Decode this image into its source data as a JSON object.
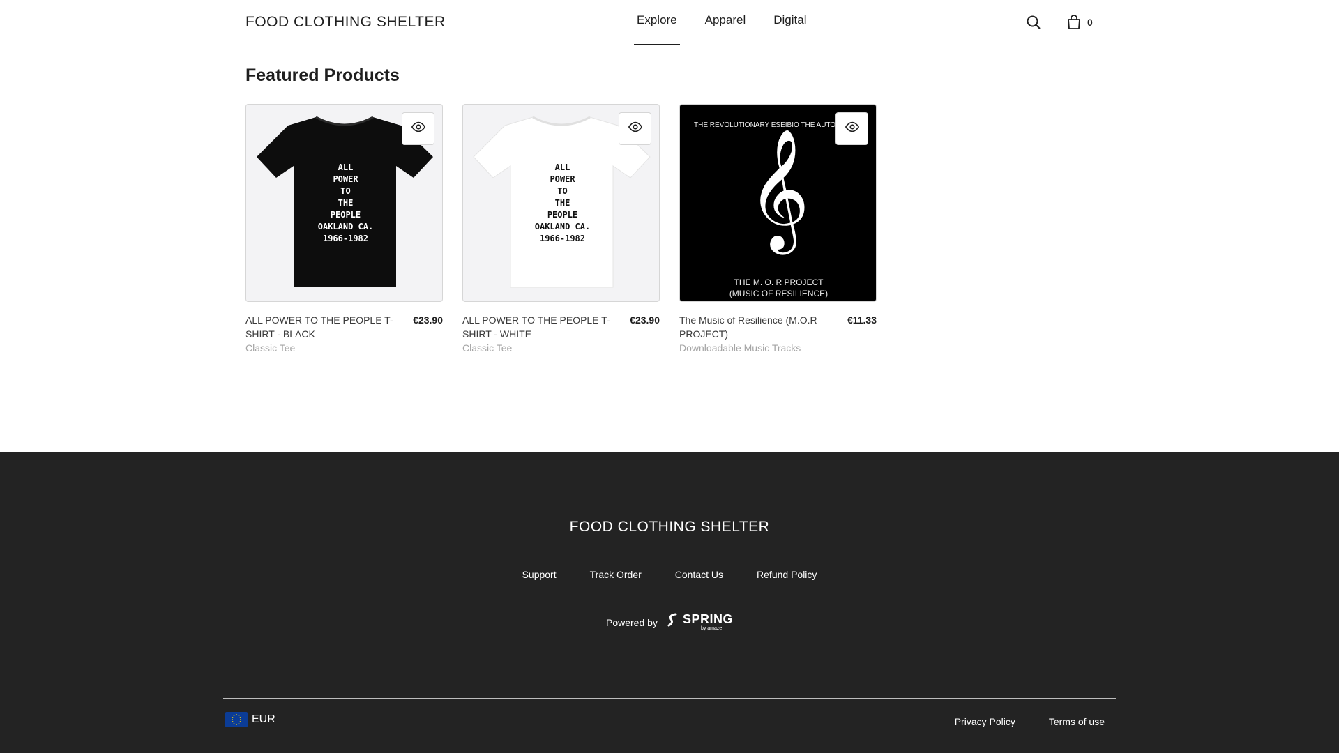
{
  "header": {
    "brand": "FOOD CLOTHING SHELTER",
    "nav": [
      {
        "label": "Explore",
        "active": true
      },
      {
        "label": "Apparel",
        "active": false
      },
      {
        "label": "Digital",
        "active": false
      }
    ],
    "cart_count": "0"
  },
  "main": {
    "section_title": "Featured Products",
    "products": [
      {
        "name": "ALL POWER TO THE PEOPLE T-SHIRT - BLACK",
        "price": "€23.90",
        "category": "Classic Tee",
        "image_text": [
          "ALL",
          "POWER",
          "TO",
          "THE",
          "PEOPLE",
          "OAKLAND CA.",
          "1966-1982"
        ]
      },
      {
        "name": "ALL POWER TO THE PEOPLE T-SHIRT - WHITE",
        "price": "€23.90",
        "category": "Classic Tee",
        "image_text": [
          "ALL",
          "POWER",
          "TO",
          "THE",
          "PEOPLE",
          "OAKLAND CA.",
          "1966-1982"
        ]
      },
      {
        "name": "The Music of Resilience (M.O.R PROJECT)",
        "price": "€11.33",
        "category": "Downloadable Music Tracks",
        "image_text_top": "THE REVOLUTIONARY ESEIBIO THE AUTO",
        "image_text_bottom_1": "THE M. O. R PROJECT",
        "image_text_bottom_2": "(MUSIC OF RESILIENCE)"
      }
    ]
  },
  "footer": {
    "brand": "FOOD CLOTHING SHELTER",
    "links": [
      "Support",
      "Track Order",
      "Contact Us",
      "Refund Policy"
    ],
    "powered_by": "Powered by",
    "spring_word": "SPRING",
    "spring_by": "by amaze",
    "currency": "EUR",
    "legal": [
      "Privacy Policy",
      "Terms of use"
    ]
  },
  "icons": {
    "search": "search-icon",
    "cart": "shopping-bag-icon",
    "quickview": "eye-icon",
    "currency_flag": "eu-flag-icon",
    "spring_logo": "spring-logo-icon"
  },
  "colors": {
    "footer_bg": "#232323",
    "text": "#1f1f1f",
    "muted": "#a5a5a5",
    "border": "#d6d6d6"
  }
}
